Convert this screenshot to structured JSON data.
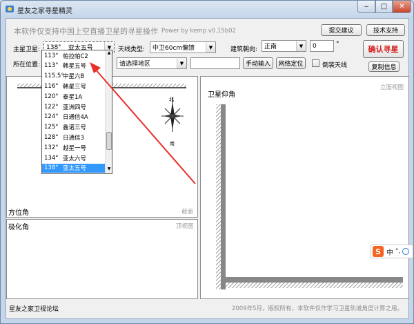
{
  "window": {
    "title": "星友之家寻星精灵",
    "minimize": "‒",
    "maximize": "□",
    "close": "✕"
  },
  "intro": {
    "text": "本软件仅支持中国上空直播卫星的寻星操作",
    "power": "Power by kemp  v0.15b02"
  },
  "buttons": {
    "feedback": "提交建议",
    "support": "技术支持",
    "confirm": "确认寻星",
    "manual": "手动输入",
    "network": "网络定位",
    "copy": "复制信息"
  },
  "form": {
    "satellite_label": "主星卫星:",
    "satellite_value_deg": "138°",
    "satellite_value_name": "亚太五号",
    "antenna_label": "天线类型:",
    "antenna_value": "中卫60cm偏馈",
    "building_label": "建筑朝向:",
    "building_value": "正南",
    "angle_value": "0",
    "degree_symbol": "°",
    "location_label": "所在位置:",
    "region_value": "请选择地区",
    "location_text": "",
    "flip_label": "倒装天线"
  },
  "dropdown": {
    "items": [
      {
        "deg": "113°",
        "name": "帕拉帕C2"
      },
      {
        "deg": "113°",
        "name": "韩星五号"
      },
      {
        "deg": "115.5°",
        "name": "中星六B"
      },
      {
        "deg": "116°",
        "name": "韩星三号"
      },
      {
        "deg": "120°",
        "name": "泰星1A"
      },
      {
        "deg": "122°",
        "name": "亚洲四号"
      },
      {
        "deg": "124°",
        "name": "日通信4A"
      },
      {
        "deg": "125°",
        "name": "鑫诺三号"
      },
      {
        "deg": "128°",
        "name": "日通信3"
      },
      {
        "deg": "132°",
        "name": "越星一号"
      },
      {
        "deg": "134°",
        "name": "亚太六号"
      },
      {
        "deg": "138°",
        "name": "亚太五号"
      }
    ],
    "selected_index": 11
  },
  "panels": {
    "azimuth_title": "方位角",
    "azimuth_hint": "截面",
    "polar_title": "极化角",
    "polar_hint": "顶视图",
    "elevation_title": "卫星仰角",
    "elevation_hint": "立面视图",
    "compass_north": "北",
    "compass_south": "南"
  },
  "footer": {
    "left": "星友之家卫视论坛",
    "right": "2009年5月，版权所有，本软件仅作学习卫星轨道角度计算之用。"
  },
  "ime": {
    "logo": "S",
    "mode": "中",
    "punct": "°,"
  },
  "colors": {
    "accent_red": "#d41a1a",
    "selection_blue": "#3399ff",
    "annotation_arrow": "#e8302a"
  }
}
